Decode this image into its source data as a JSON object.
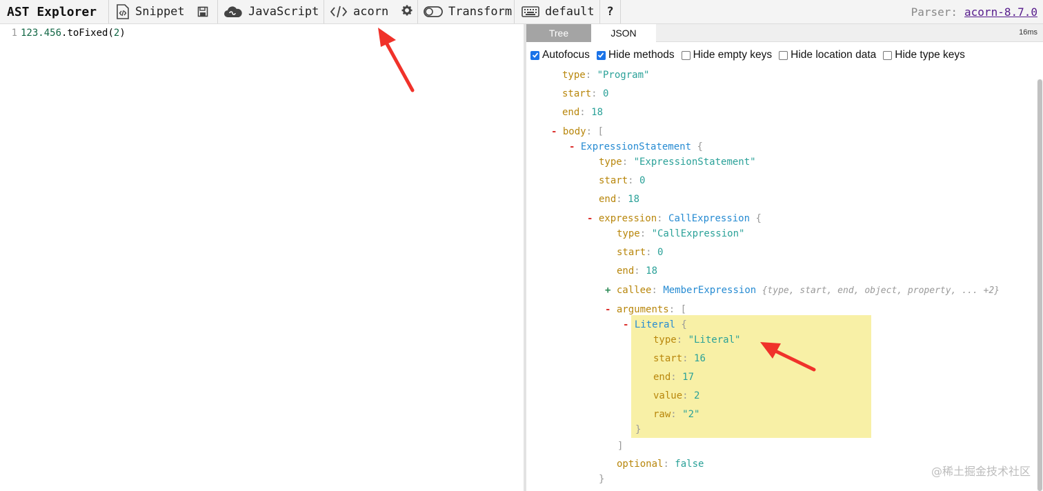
{
  "toolbar": {
    "brand": "AST Explorer",
    "snippet_label": "Snippet",
    "language_label": "JavaScript",
    "parser_label": "acorn",
    "transform_label": "Transform",
    "keymap_label": "default",
    "help_label": "?",
    "parser_prefix": "Parser:",
    "parser_version": "acorn-8.7.0"
  },
  "editor": {
    "line_number": "1",
    "code_num": "123.456",
    "code_method": ".toFixed(",
    "code_arg": "2",
    "code_close": ")"
  },
  "output": {
    "tabs": [
      {
        "label": "Tree"
      },
      {
        "label": "JSON"
      }
    ],
    "timing": "16ms",
    "options": [
      {
        "label": "Autofocus",
        "checked": true
      },
      {
        "label": "Hide methods",
        "checked": true
      },
      {
        "label": "Hide empty keys",
        "checked": false
      },
      {
        "label": "Hide location data",
        "checked": false
      },
      {
        "label": "Hide type keys",
        "checked": false
      }
    ]
  },
  "tree": {
    "root_type": "\"Program\"",
    "root_start": "0",
    "root_end": "18",
    "expr_stmt_type_name": "ExpressionStatement",
    "expr_stmt_type_value": "\"ExpressionStatement\"",
    "expr_stmt_start": "0",
    "expr_stmt_end": "18",
    "call_type_name": "CallExpression",
    "call_type_value": "\"CallExpression\"",
    "call_start": "0",
    "call_end": "18",
    "callee_type": "MemberExpression",
    "callee_summary": "{type, start, end, object, property, ... +2}",
    "literal_name": "Literal",
    "literal_type": "\"Literal\"",
    "literal_start": "16",
    "literal_end": "17",
    "literal_value": "2",
    "literal_raw": "\"2\"",
    "optional_value": "false"
  },
  "keys": {
    "type": "type",
    "start": "start",
    "end": "end",
    "body": "body",
    "expression": "expression",
    "callee": "callee",
    "arguments": "arguments",
    "value": "value",
    "raw": "raw",
    "optional": "optional"
  },
  "watermark": "@稀土掘金技术社区",
  "colors": {
    "key": "#b8860b",
    "string": "#2aa198",
    "type": "#268bd2",
    "highlight": "#f8f0a6",
    "arrow": "#f0322a"
  }
}
